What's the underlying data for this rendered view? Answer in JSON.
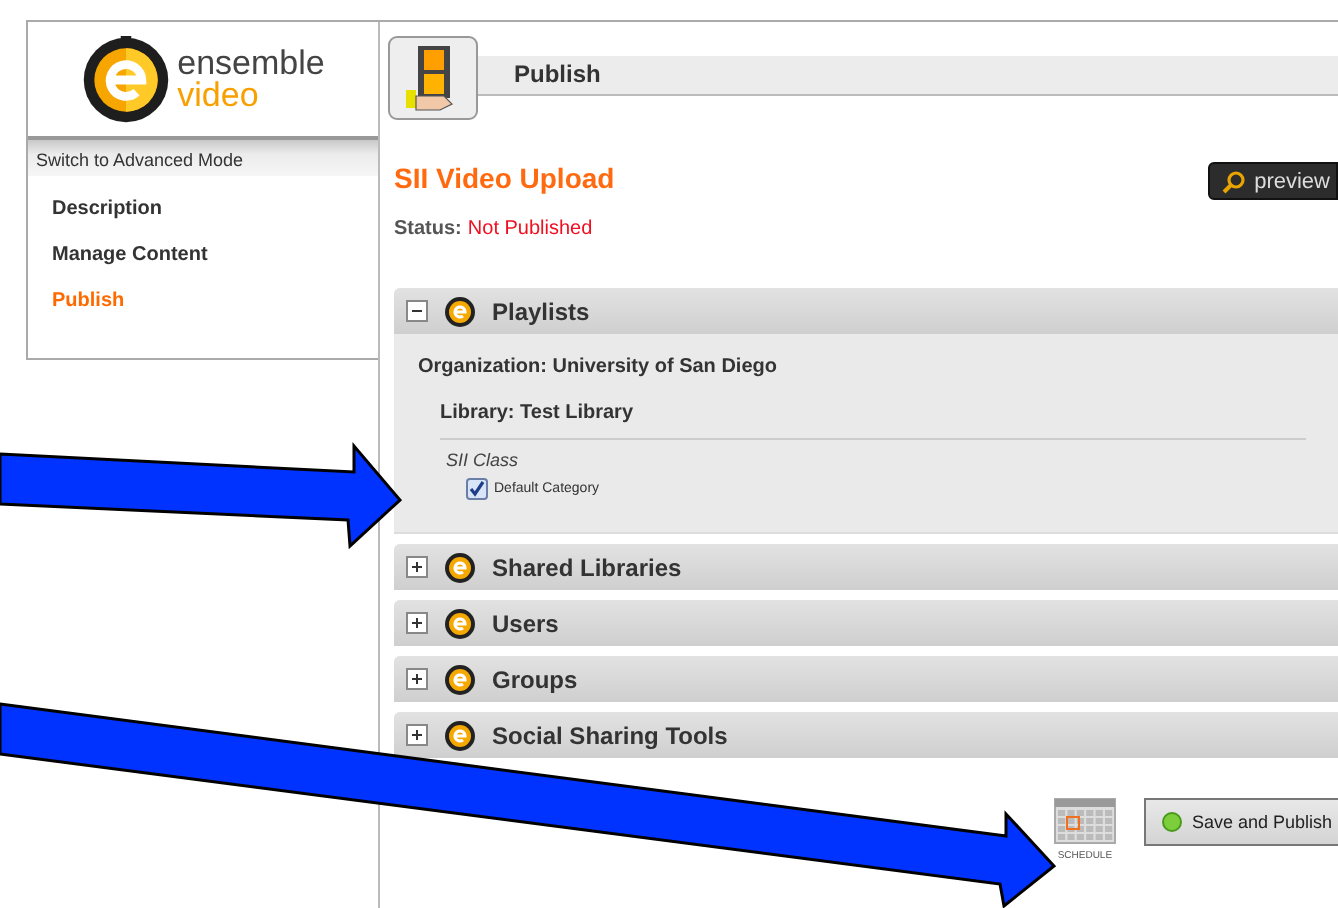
{
  "logo": {
    "word_top": "ensemble",
    "word_bottom": "video"
  },
  "sidebar": {
    "mode_switch": "Switch to Advanced Mode",
    "items": [
      {
        "label": "Description",
        "selected": false
      },
      {
        "label": "Manage Content",
        "selected": false
      },
      {
        "label": "Publish",
        "selected": true
      }
    ]
  },
  "header": {
    "title": "Publish"
  },
  "video": {
    "title": "SII Video Upload",
    "status_label": "Status:",
    "status_value": "Not Published",
    "preview_button": "preview"
  },
  "sections": [
    {
      "title": "Playlists",
      "expanded": true,
      "organization": "Organization: University of San Diego",
      "library": "Library: Test Library",
      "class_name": "SII Class",
      "categories": [
        {
          "label": "Default Category",
          "checked": true
        }
      ]
    },
    {
      "title": "Shared Libraries",
      "expanded": false
    },
    {
      "title": "Users",
      "expanded": false
    },
    {
      "title": "Groups",
      "expanded": false
    },
    {
      "title": "Social Sharing Tools",
      "expanded": false
    }
  ],
  "actions": {
    "schedule_label": "SCHEDULE",
    "save_button": "Save and Publish"
  }
}
